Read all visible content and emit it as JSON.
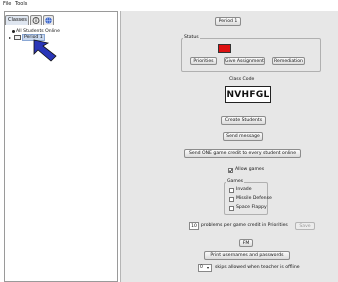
{
  "menubar": {
    "file": "File",
    "tools": "Tools"
  },
  "left": {
    "tabs": {
      "classes": "Classes"
    },
    "tree": [
      {
        "label": "All Students Online"
      },
      {
        "label": "Period 1"
      }
    ]
  },
  "right": {
    "period_button": "Period 1",
    "status": {
      "title": "Status",
      "indicator_color": "#dd1111",
      "buttons": [
        "Priorities",
        "Give Assignment",
        "Remediation"
      ]
    },
    "class_code": {
      "title": "Class Code",
      "value": "NVHFGL"
    },
    "create_students": "Create Students",
    "send_message": "Send message",
    "send_credit": "Send ONE game credit to every student online",
    "allow_games": {
      "label": "Allow games",
      "checked": true
    },
    "games": {
      "title": "Games",
      "items": [
        {
          "label": "Invade",
          "checked": false
        },
        {
          "label": "Missile Defense",
          "checked": false
        },
        {
          "label": "Space Flappy",
          "checked": false
        }
      ]
    },
    "problems": {
      "value": "10",
      "label": "problems per game credit in Priorities",
      "save": "Save"
    },
    "fm_button": "FM",
    "print_button": "Print usernames and passwords",
    "skips": {
      "value": "0",
      "label": "skips allowed when teacher is offline"
    }
  }
}
